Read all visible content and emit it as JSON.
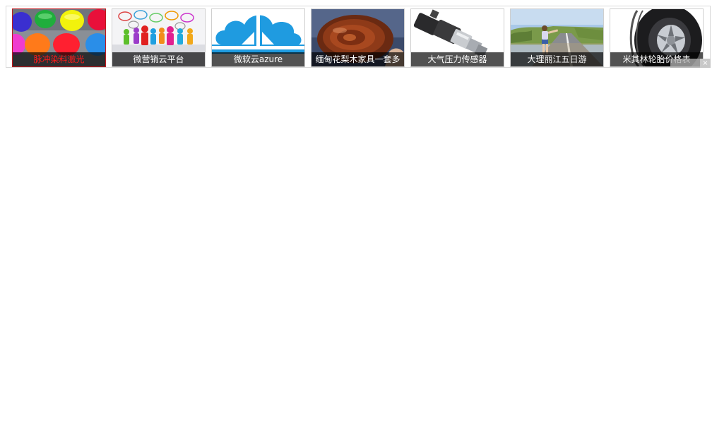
{
  "ad_strip": {
    "items": [
      {
        "caption": "脉冲染料激光",
        "image": "colorful-dye-cups",
        "active": true
      },
      {
        "caption": "微营销云平台",
        "image": "social-figures-speech-bubbles",
        "active": false
      },
      {
        "caption": "微软云azure",
        "image": "azure-cloud-logo",
        "active": false
      },
      {
        "caption": "缅甸花梨木家具一套多",
        "image": "rosewood-slice",
        "active": false
      },
      {
        "caption": "大气压力传感器",
        "image": "pressure-sensor",
        "active": false
      },
      {
        "caption": "大理丽江五日游",
        "image": "girl-on-road",
        "active": false
      },
      {
        "caption": "米其林轮胎价格表",
        "image": "tire",
        "active": false
      }
    ],
    "active_caption_color": "#ff1a1a",
    "caption_color": "#ffffff"
  },
  "ad_badge": {
    "close_glyph": "×"
  }
}
